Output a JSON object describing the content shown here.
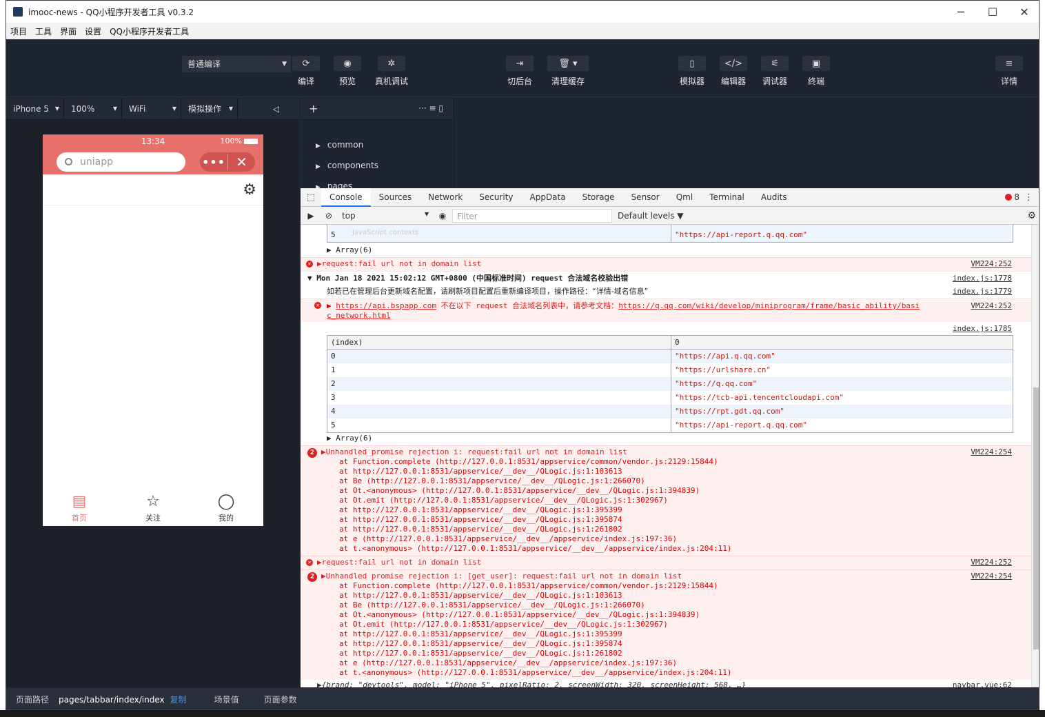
{
  "window": {
    "title": "imooc-news - QQ小程序开发者工具 v0.3.2",
    "minimize": "─",
    "maximize": "☐",
    "close": "✕"
  },
  "menubar": [
    "项目",
    "工具",
    "界面",
    "设置",
    "QQ小程序开发者工具"
  ],
  "toolbar": {
    "compile_mode": "普通编译",
    "buttons": [
      {
        "label": "编译",
        "icon": "⟳"
      },
      {
        "label": "预览",
        "icon": "◉"
      },
      {
        "label": "真机调试",
        "icon": "✲"
      },
      {
        "label": "切后台",
        "icon": "⇥"
      },
      {
        "label": "清理缓存",
        "icon": "🗑 ▾"
      },
      {
        "label": "模拟器",
        "icon": "▯"
      },
      {
        "label": "编辑器",
        "icon": "</>"
      },
      {
        "label": "调试器",
        "icon": "⚟"
      },
      {
        "label": "终端",
        "icon": "▣"
      },
      {
        "label": "详情",
        "icon": "≡"
      }
    ]
  },
  "simulator": {
    "device": "iPhone 5",
    "zoom": "100%",
    "network": "WiFi",
    "operation": "模拟操作",
    "status_time": "13:34",
    "battery": "100%",
    "search_placeholder": "uniapp",
    "capsule_more": "•••",
    "capsule_close": "✕",
    "tabs": [
      {
        "label": "首页",
        "icon": "▤"
      },
      {
        "label": "关注",
        "icon": "☆"
      },
      {
        "label": "我的",
        "icon": "◯"
      }
    ]
  },
  "filetree": {
    "add": "+",
    "tools": "··· ≡ ▯",
    "items": [
      "common",
      "components",
      "pages"
    ]
  },
  "devtools": {
    "tabs": [
      "Console",
      "Sources",
      "Network",
      "Security",
      "AppData",
      "Storage",
      "Sensor",
      "Qml",
      "Terminal",
      "Audits"
    ],
    "error_count": "8",
    "context": "top",
    "filter_placeholder": "Filter",
    "levels": "Default levels ▼",
    "js_contexts_hint": "JavaScript contexts"
  },
  "console": {
    "first_table_last": {
      "index": "5",
      "value": "\"https://api-report.q.qq.com\""
    },
    "array1": "▶ Array(6)",
    "msg1": {
      "text": "▶request:fail url not in domain list",
      "src": "VM224:252"
    },
    "group": {
      "text": "▼ Mon Jan 18 2021 15:02:12 GMT+0800 (中国标准时间) request 合法域名校验出错",
      "src": "index.js:1778"
    },
    "info": {
      "text": "如若已在管理后台更新域名配置，请刷新项目配置后重新编译项目，操作路径：“详情-域名信息”",
      "src": "index.js:1779"
    },
    "domain_err": {
      "link1": "https://api.bspapp.com",
      "mid": " 不在以下 request 合法域名列表中，请参考文档：",
      "link2": "https://q.qq.com/wiki/develop/miniprogram/frame/basic_ability/basi",
      "link3": "c_network.html",
      "src": "VM224:252"
    },
    "table_src": "index.js:1785",
    "table_headers": [
      "(index)",
      "0"
    ],
    "table_rows": [
      [
        "0",
        "\"https://api.q.qq.com\""
      ],
      [
        "1",
        "\"https://urlshare.cn\""
      ],
      [
        "2",
        "\"https://q.qq.com\""
      ],
      [
        "3",
        "\"https://tcb-api.tencentcloudapi.com\""
      ],
      [
        "4",
        "\"https://rpt.gdt.qq.com\""
      ],
      [
        "5",
        "\"https://api-report.q.qq.com\""
      ]
    ],
    "array2": "▶ Array(6)",
    "rej1": {
      "count": "2",
      "text": "▶Unhandled promise rejection i: request:fail url not in domain list",
      "src": "VM224:254"
    },
    "stack1": [
      "at Function.complete (http://127.0.0.1:8531/appservice/common/vendor.js:2129:15844)",
      "at http://127.0.0.1:8531/appservice/__dev__/QLogic.js:1:103613",
      "at Be (http://127.0.0.1:8531/appservice/__dev__/QLogic.js:1:266070)",
      "at Ot.<anonymous> (http://127.0.0.1:8531/appservice/__dev__/QLogic.js:1:394839)",
      "at Ot.emit (http://127.0.0.1:8531/appservice/__dev__/QLogic.js:1:302967)",
      "at http://127.0.0.1:8531/appservice/__dev__/QLogic.js:1:395399",
      "at http://127.0.0.1:8531/appservice/__dev__/QLogic.js:1:395874",
      "at http://127.0.0.1:8531/appservice/__dev__/QLogic.js:1:261802",
      "at e (http://127.0.0.1:8531/appservice/__dev__/appservice/index.js:197:36)",
      "at t.<anonymous> (http://127.0.0.1:8531/appservice/__dev__/appservice/index.js:204:11)"
    ],
    "msg2": {
      "text": "▶request:fail url not in domain list",
      "src": "VM224:252"
    },
    "rej2": {
      "count": "2",
      "text": "▶Unhandled promise rejection i: [get_user]: request:fail url not in domain list",
      "src": "VM224:254"
    },
    "last_line": {
      "text": "▶{brand: \"devtools\", model: \"iPhone 5\", pixelRatio: 2, screenWidth: 320, screenHeight: 568, …}",
      "src": "navbar.vue:62"
    }
  },
  "bottombar": {
    "path_label": "页面路径",
    "path": "pages/tabbar/index/index",
    "copy": "复制",
    "scene": "场景值",
    "params": "页面参数"
  }
}
